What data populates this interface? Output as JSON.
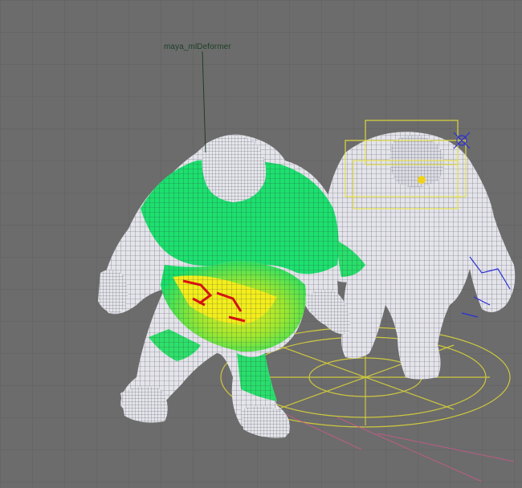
{
  "viewport": {
    "deformer_label": "maya_mlDeformer",
    "background_color": "#6c6c6c",
    "grid_color": "#5e5e5e",
    "heatmap_colors": [
      "#19e06a",
      "#8ee830",
      "#f2ee1c",
      "#e01010"
    ],
    "mesh_color": "#e4e4ea",
    "wire_color": "#2b2d3a",
    "rig_controls_color": "#e8e23a",
    "rig_joints_color": "#2a2fd8"
  }
}
